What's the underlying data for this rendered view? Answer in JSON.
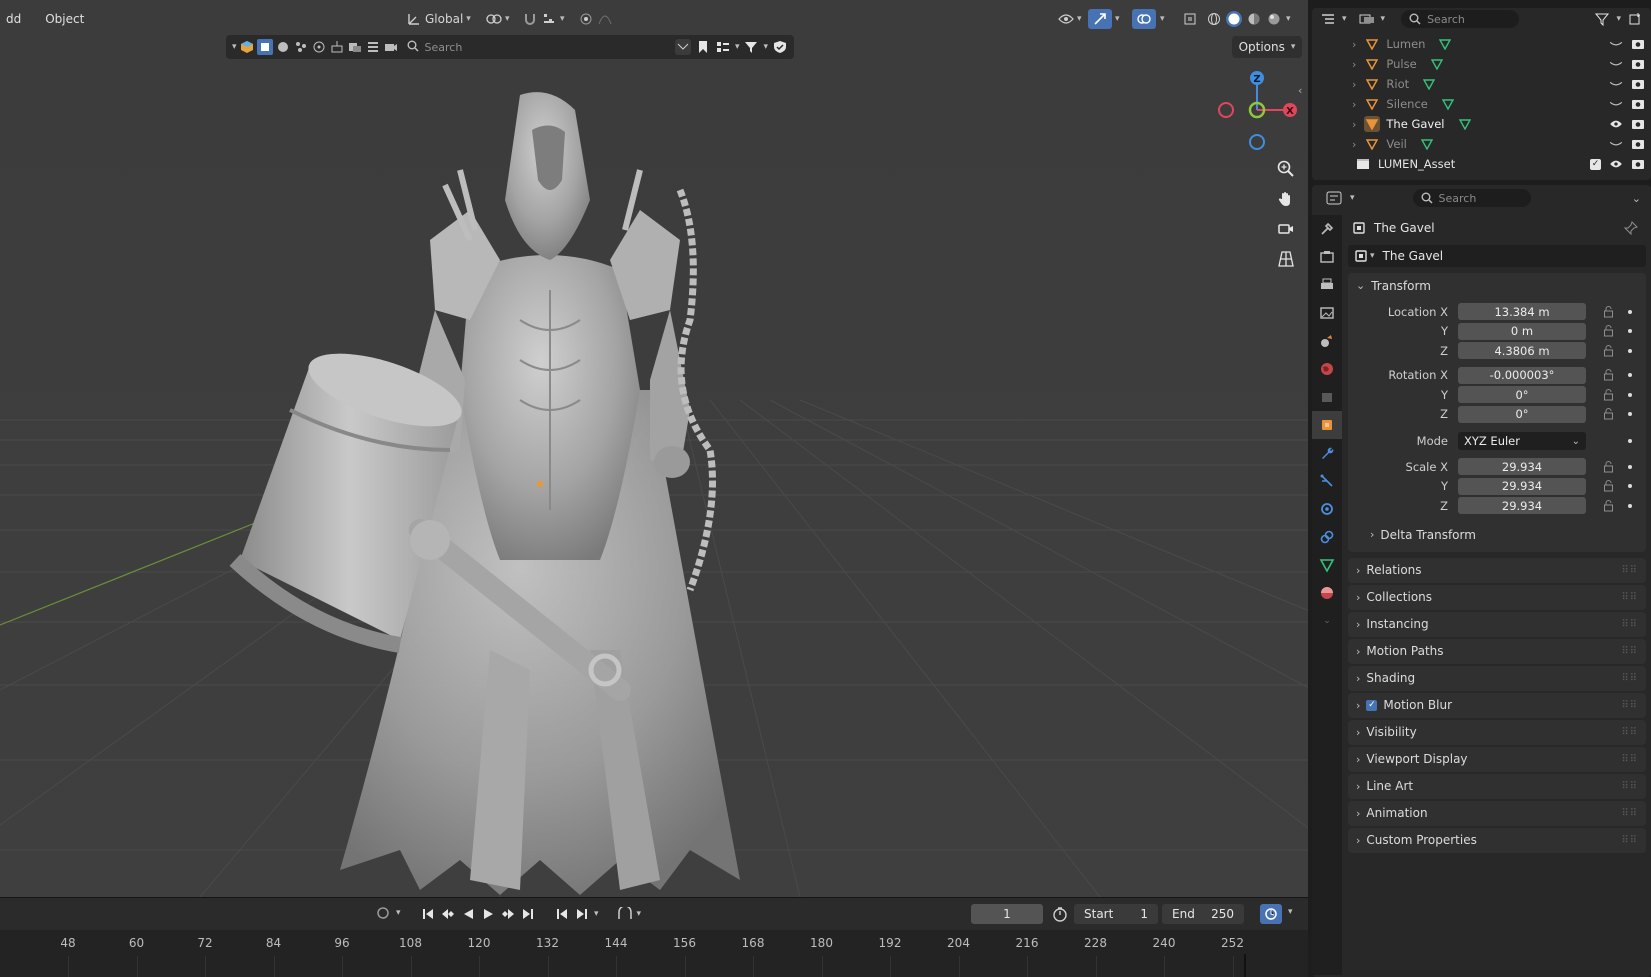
{
  "viewport": {
    "menu": [
      "dd",
      "Object"
    ],
    "orientation_label": "Global",
    "search_placeholder": "Search",
    "options_label": "Options",
    "gizmo": {
      "z": "Z",
      "x": "X"
    },
    "colors": {
      "x_axis": "#e0475b",
      "y_axis": "#8fc73e",
      "z_axis": "#3f8ee0",
      "active": "#4772b3"
    }
  },
  "timeline": {
    "current_frame": "1",
    "start_label": "Start",
    "start_value": "1",
    "end_label": "End",
    "end_value": "250",
    "ticks": [
      "48",
      "60",
      "72",
      "84",
      "96",
      "108",
      "120",
      "132",
      "144",
      "156",
      "168",
      "180",
      "192",
      "204",
      "216",
      "228",
      "240",
      "252"
    ]
  },
  "outliner": {
    "search_placeholder": "Search",
    "items": [
      {
        "label": "Lumen",
        "selected": false
      },
      {
        "label": "Pulse",
        "selected": false
      },
      {
        "label": "Riot",
        "selected": false
      },
      {
        "label": "Silence",
        "selected": false
      },
      {
        "label": "The Gavel",
        "selected": true
      },
      {
        "label": "Veil",
        "selected": false
      }
    ],
    "collection": "LUMEN_Asset"
  },
  "properties": {
    "search_placeholder": "Search",
    "object_title": "The Gavel",
    "object_name": "The Gavel",
    "transform": {
      "title": "Transform",
      "location_label": "Location X",
      "location": [
        "13.384 m",
        "0 m",
        "4.3806 m"
      ],
      "rotation_label": "Rotation X",
      "rotation": [
        "-0.000003°",
        "0°",
        "0°"
      ],
      "mode_label": "Mode",
      "mode_value": "XYZ Euler",
      "scale_label": "Scale X",
      "scale": [
        "29.934",
        "29.934",
        "29.934"
      ],
      "y_label": "Y",
      "z_label": "Z",
      "delta": "Delta Transform"
    },
    "panels": [
      "Relations",
      "Collections",
      "Instancing",
      "Motion Paths",
      "Shading",
      "Motion Blur",
      "Visibility",
      "Viewport Display",
      "Line Art",
      "Animation",
      "Custom Properties"
    ]
  }
}
